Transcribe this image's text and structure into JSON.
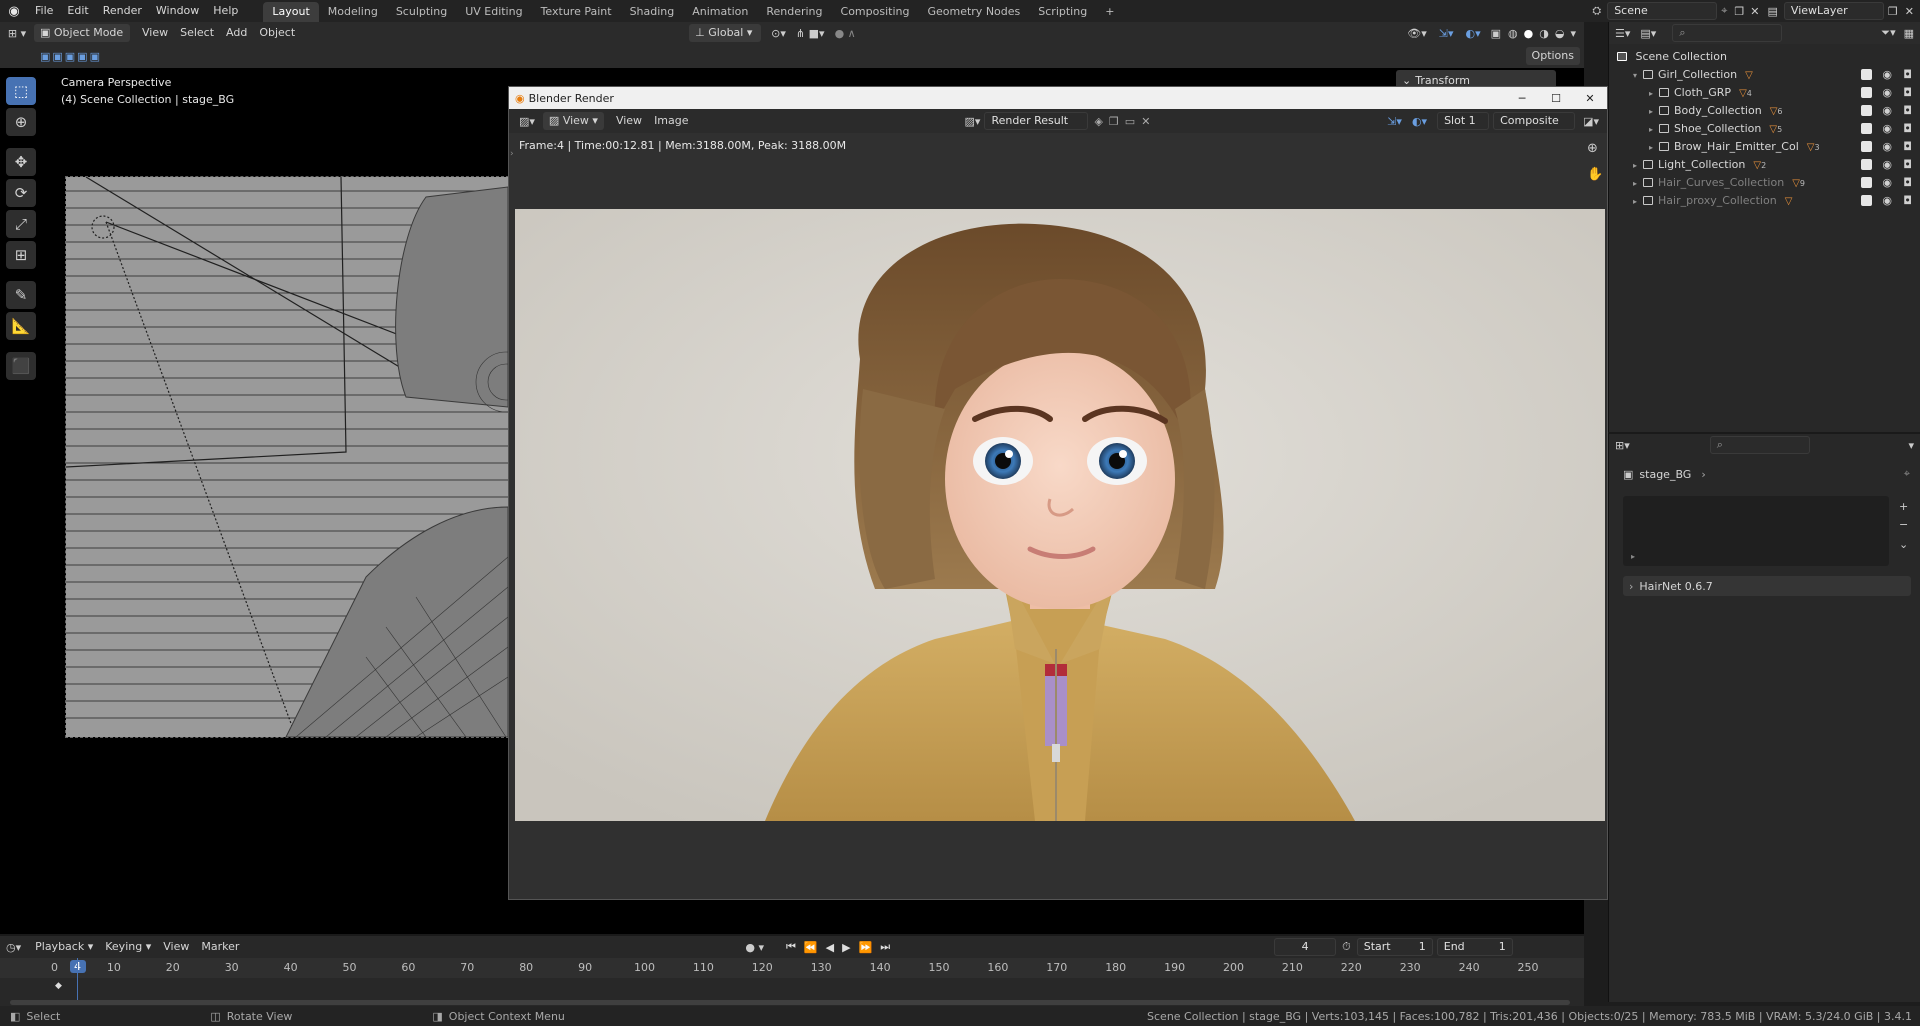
{
  "topbar": {
    "menus": [
      "File",
      "Edit",
      "Render",
      "Window",
      "Help"
    ],
    "workspaces": [
      "Layout",
      "Modeling",
      "Sculpting",
      "UV Editing",
      "Texture Paint",
      "Shading",
      "Animation",
      "Rendering",
      "Compositing",
      "Geometry Nodes",
      "Scripting"
    ],
    "active_workspace": "Layout",
    "add_tab": "+",
    "scene": "Scene",
    "view_layer": "ViewLayer"
  },
  "viewport": {
    "mode": "Object Mode",
    "menus": [
      "View",
      "Select",
      "Add",
      "Object"
    ],
    "orientation": "Global",
    "options": "Options",
    "camera_label": "Camera Perspective",
    "collection_label": "(4) Scene Collection | stage_BG",
    "transform_panel": "Transform"
  },
  "render_window": {
    "title": "Blender Render",
    "menus": [
      "View",
      "View",
      "Image"
    ],
    "image_name": "Render Result",
    "slot": "Slot 1",
    "pass": "Composite",
    "stats": "Frame:4 | Time:00:12.81 | Mem:3188.00M, Peak: 3188.00M"
  },
  "outliner": {
    "root": "Scene Collection",
    "items": [
      {
        "name": "Girl_Collection",
        "level": 1,
        "badge": "",
        "dim": false
      },
      {
        "name": "Cloth_GRP",
        "level": 2,
        "badge": "4",
        "dim": false
      },
      {
        "name": "Body_Collection",
        "level": 2,
        "badge": "6",
        "dim": false
      },
      {
        "name": "Shoe_Collection",
        "level": 2,
        "badge": "5",
        "dim": false
      },
      {
        "name": "Brow_Hair_Emitter_Col",
        "level": 2,
        "badge": "3",
        "dim": false
      },
      {
        "name": "Light_Collection",
        "level": 1,
        "badge": "2",
        "dim": false
      },
      {
        "name": "Hair_Curves_Collection",
        "level": 1,
        "badge": "9",
        "dim": true
      },
      {
        "name": "Hair_proxy_Collection",
        "level": 1,
        "badge": "",
        "dim": true
      }
    ]
  },
  "properties": {
    "object": "stage_BG",
    "addon_panel": "HairNet 0.6.7"
  },
  "timeline": {
    "menus": [
      "Playback",
      "Keying",
      "View",
      "Marker"
    ],
    "current_frame": "4",
    "start_label": "Start",
    "start": "1",
    "end_label": "End",
    "end": "1",
    "ticks": [
      "0",
      "10",
      "20",
      "30",
      "40",
      "50",
      "60",
      "70",
      "80",
      "90",
      "100",
      "110",
      "120",
      "130",
      "140",
      "150",
      "160",
      "170",
      "180",
      "190",
      "200",
      "210",
      "220",
      "230",
      "240",
      "250"
    ]
  },
  "status": {
    "select": "Select",
    "rotate": "Rotate View",
    "context": "Object Context Menu",
    "info": "Scene Collection | stage_BG | Verts:103,145 | Faces:100,782 | Tris:201,436 | Objects:0/25 | Memory: 783.5 MiB | VRAM: 5.3/24.0 GiB | 3.4.1"
  },
  "colors": {
    "accent": "#4772b3",
    "orange": "#e8913a",
    "jacket": "#c9a45a",
    "hair": "#7a5a36"
  }
}
